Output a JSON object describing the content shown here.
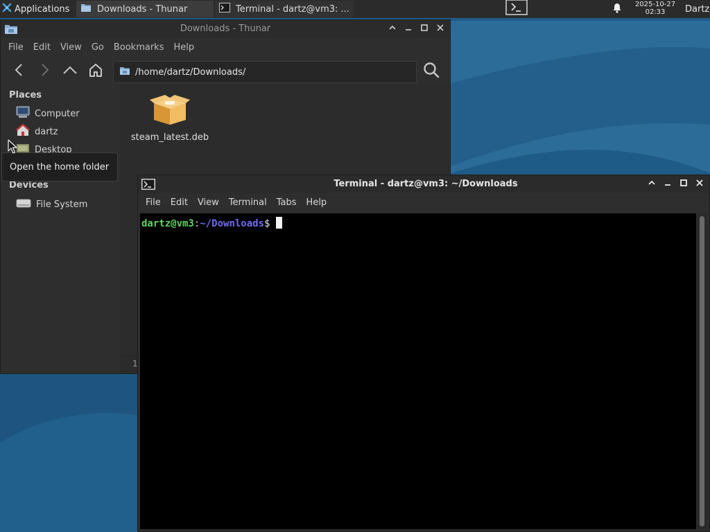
{
  "panel": {
    "apps_label": "Applications",
    "tasks": [
      {
        "label": "Downloads - Thunar",
        "active": true
      },
      {
        "label": "Terminal - dartz@vm3: ...",
        "active": false
      }
    ],
    "clock_date": "2025-10-27",
    "clock_time": "02:33",
    "user": "Dartz"
  },
  "thunar": {
    "title": "Downloads - Thunar",
    "menu": [
      "File",
      "Edit",
      "View",
      "Go",
      "Bookmarks",
      "Help"
    ],
    "location": "/home/dartz/Downloads/",
    "sidebar": {
      "places_heading": "Places",
      "places": [
        "Computer",
        "dartz",
        "Desktop"
      ],
      "devices_heading": "Devices",
      "devices": [
        "File System"
      ]
    },
    "files": [
      {
        "name": "steam_latest.deb",
        "icon": "package-icon"
      }
    ],
    "status_text": "1"
  },
  "tooltip": {
    "text": "Open the home folder"
  },
  "terminal": {
    "title": "Terminal - dartz@vm3: ~/Downloads",
    "menu": [
      "File",
      "Edit",
      "View",
      "Terminal",
      "Tabs",
      "Help"
    ],
    "prompt": {
      "user_host": "dartz@vm3",
      "separator": ":",
      "path": "~/Downloads",
      "symbol": "$"
    }
  },
  "colors": {
    "panel_bg": "#2b2b2b",
    "window_bg": "#2e2e2e",
    "terminal_bg": "#000000",
    "prompt_user": "#5fd35f",
    "prompt_path": "#6f6cf0",
    "wallpaper": "#1d5a86"
  }
}
